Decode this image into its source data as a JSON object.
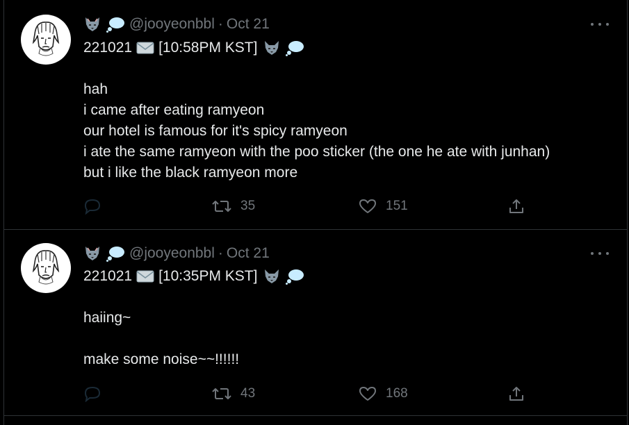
{
  "tweets": [
    {
      "handle": "@jooyeonbbl",
      "separator": "·",
      "date": "Oct 21",
      "line_id": "221021",
      "line_time": "[10:58PM KST]",
      "text": [
        "hah",
        "i came after eating ramyeon",
        "our hotel is famous for it's spicy ramyeon",
        "i ate the same ramyeon with the poo sticker (the one he ate with junhan)",
        "but i like the black ramyeon more"
      ],
      "retweets": "35",
      "likes": "151"
    },
    {
      "handle": "@jooyeonbbl",
      "separator": "·",
      "date": "Oct 21",
      "line_id": "221021",
      "line_time": "[10:35PM KST]",
      "text": [
        "haiing~",
        "",
        "make some noise~~!!!!!!"
      ],
      "retweets": "43",
      "likes": "168"
    }
  ],
  "icons": {
    "header_emoji_1": "wolf-icon",
    "header_emoji_2": "thought-bubble-icon",
    "envelope": "envelope-icon",
    "reply": "reply-icon",
    "retweet": "retweet-icon",
    "like": "heart-icon",
    "share": "share-icon",
    "more": "more-options-icon"
  },
  "colors": {
    "background": "#000000",
    "text_primary": "#e7e9ea",
    "text_secondary": "#71767b",
    "divider": "#2f3336",
    "reply_icon": "#1a2a36"
  }
}
